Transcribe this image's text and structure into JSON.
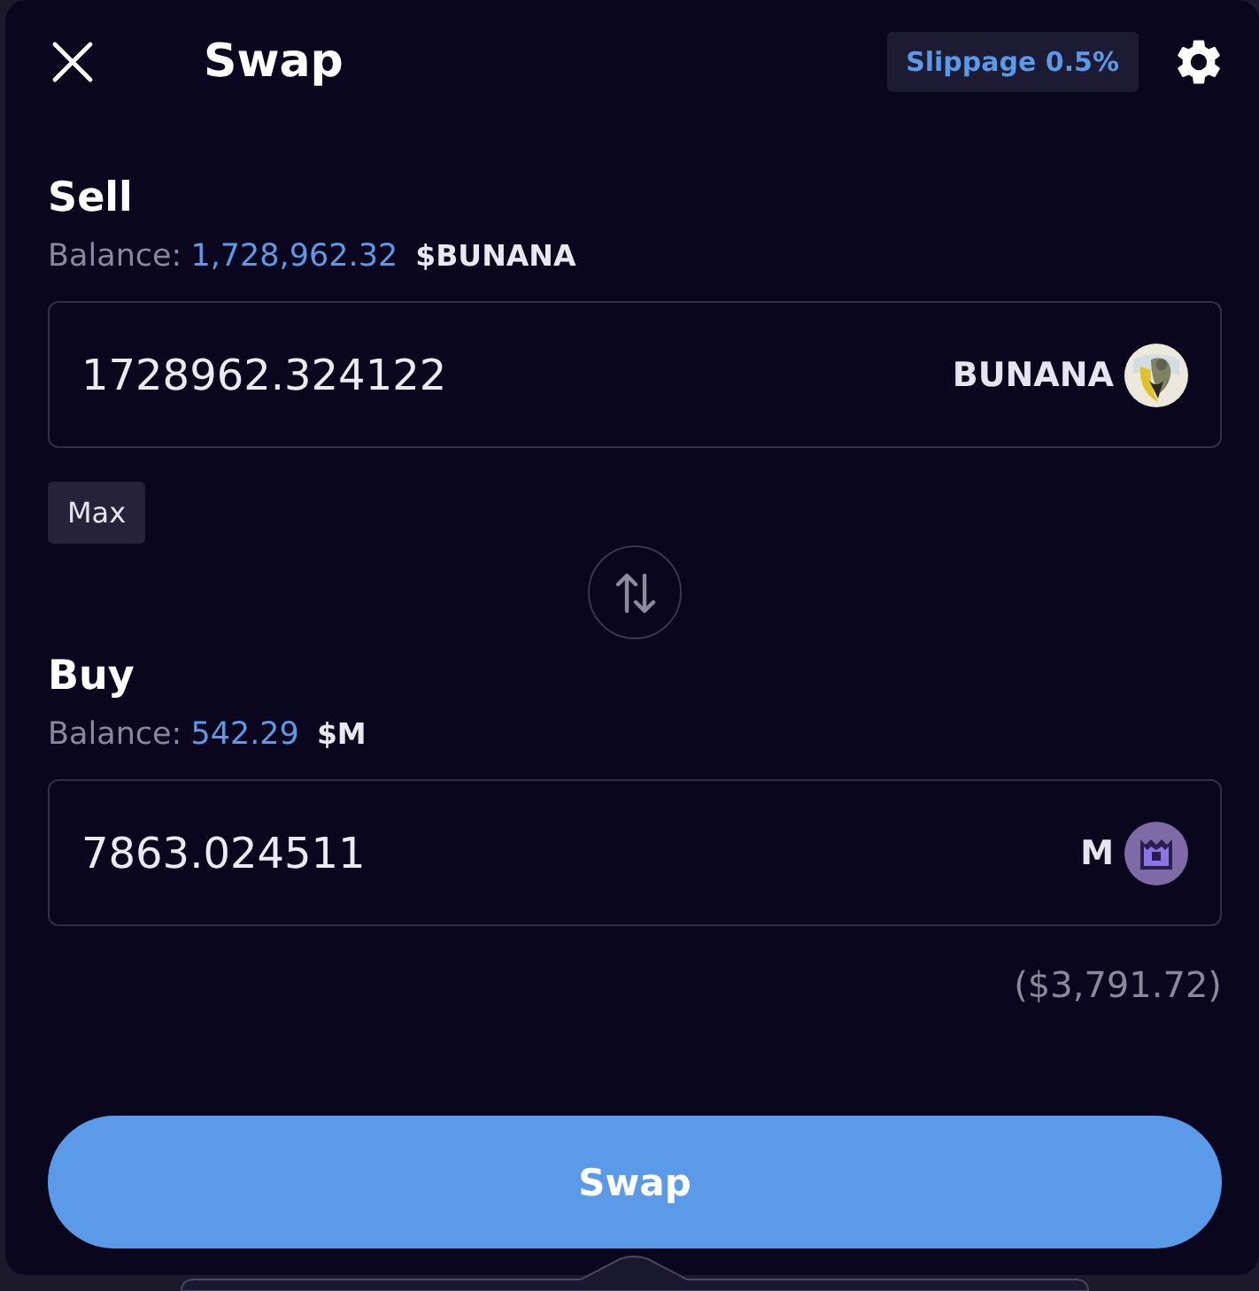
{
  "header": {
    "title": "Swap",
    "slippage": "Slippage 0.5%"
  },
  "sell": {
    "label": "Sell",
    "balance_label": "Balance:",
    "balance": "1,728,962.32",
    "balance_symbol": "$BUNANA",
    "amount": "1728962.324122",
    "token": "BUNANA",
    "max_button": "Max"
  },
  "buy": {
    "label": "Buy",
    "balance_label": "Balance:",
    "balance": "542.29",
    "balance_symbol": "$M",
    "amount": "7863.024511",
    "token": "M",
    "usd_value": "($3,791.72)"
  },
  "swap_button": "Swap"
}
